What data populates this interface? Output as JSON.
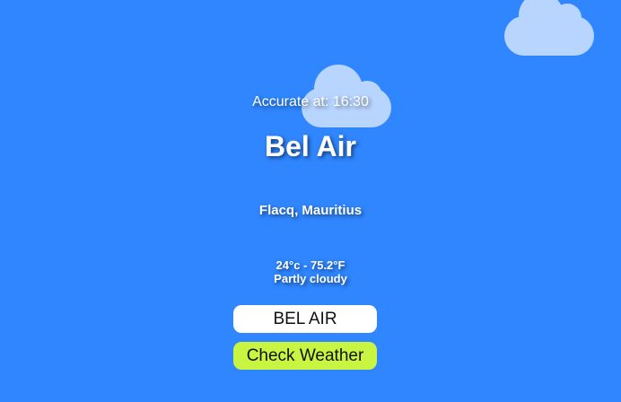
{
  "weather": {
    "accurate_at": "Accurate at: 16:30",
    "city": "Bel Air",
    "region": "Flacq, Mauritius",
    "temperature": "24°c - 75.2°F",
    "condition": "Partly cloudy"
  },
  "form": {
    "city_input_value": "BEL AIR",
    "check_button_label": "Check Weather"
  },
  "icons": {
    "top_right": "cloud-icon",
    "center": "cloud-icon"
  },
  "colors": {
    "background": "#2f86ff",
    "cloud": "#c4dcff",
    "button_accent": "#c8f542",
    "input_background": "#ffffff",
    "text": "#ffffff"
  }
}
